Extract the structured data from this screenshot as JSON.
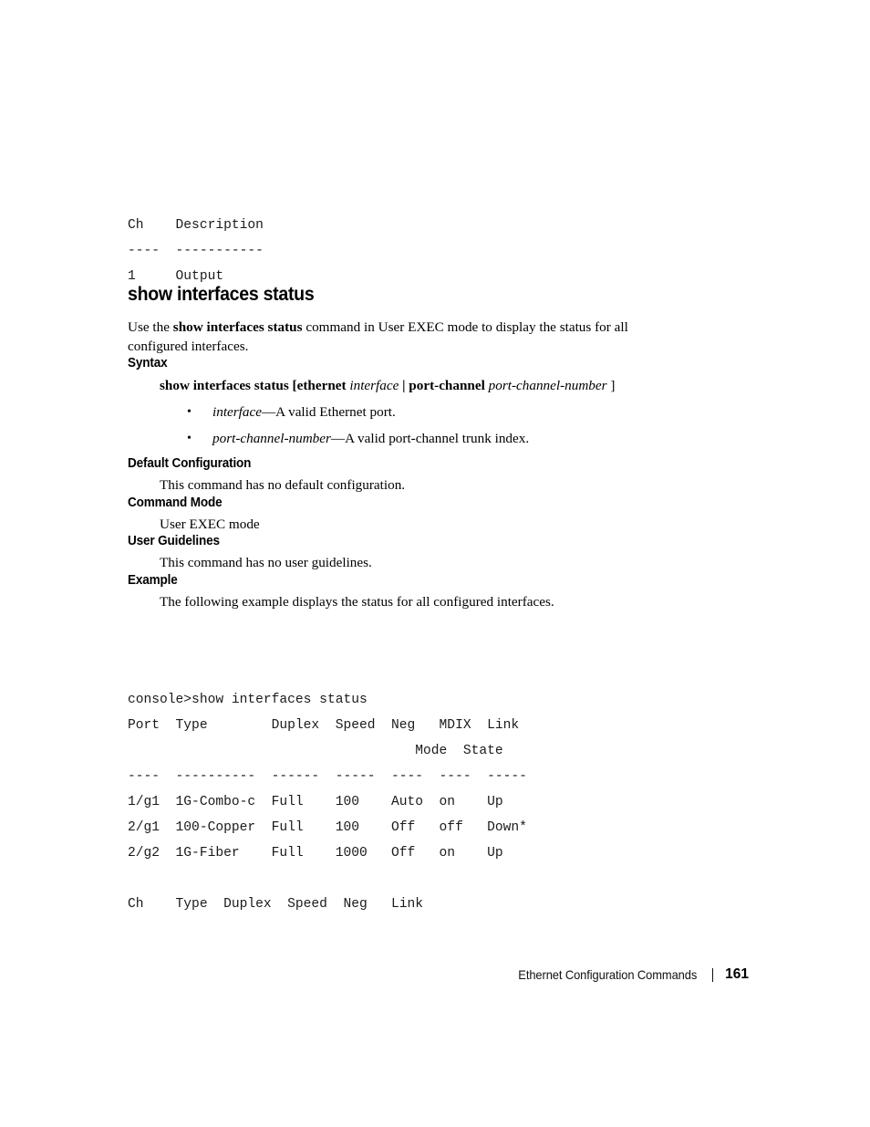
{
  "top_console": {
    "lines": [
      "Ch    Description",
      "----  -----------",
      "1     Output"
    ],
    "text": "Ch    Description\n----  -----------\n1     Output"
  },
  "command": {
    "heading": "show interfaces status",
    "intro": "Use the show interfaces status command in User EXEC mode to display the status for all configured interfaces.",
    "intro_lead": "Use the ",
    "intro_bold": "show interfaces status",
    "intro_rest": " command in User EXEC mode to display the status for all configured interfaces."
  },
  "sections": {
    "syntax": {
      "heading": "Syntax",
      "line": {
        "part1_bold": "show interfaces status [ethernet",
        "part2_italic": "interface",
        "part3_bold": "| port-channel",
        "part4_italic": "port-channel-number",
        "part5": "]"
      },
      "bullets": [
        {
          "term": "interface",
          "desc": "—A valid Ethernet port.",
          "marker": "•"
        },
        {
          "term": "port-channel-number",
          "desc": "—A valid port-channel trunk index.",
          "marker": "•"
        }
      ]
    },
    "default_configuration": {
      "heading": "Default Configuration",
      "body": "This command has no default configuration."
    },
    "command_mode": {
      "heading": "Command Mode",
      "body": "User EXEC mode"
    },
    "user_guidelines": {
      "heading": "User Guidelines",
      "body": "This command has no user guidelines."
    },
    "example": {
      "heading": "Example",
      "body": "The following example displays the status for all configured interfaces."
    }
  },
  "example_console": {
    "prompt_line": "console>show interfaces status",
    "port_table": {
      "headers_row1": [
        "Port",
        "Type",
        "Duplex",
        "Speed",
        "Neg",
        "MDIX",
        "Link"
      ],
      "headers_row2": [
        "",
        "",
        "",
        "",
        "",
        "Mode",
        "State"
      ],
      "separators": [
        "----",
        "----------",
        "------",
        "-----",
        "----",
        "----",
        "-----"
      ],
      "rows": [
        [
          "1/g1",
          "1G-Combo-c",
          "Full",
          "100",
          "Auto",
          "on",
          "Up"
        ],
        [
          "2/g1",
          "100-Copper",
          "Full",
          "100",
          "Off",
          "off",
          "Down*"
        ],
        [
          "2/g2",
          "1G-Fiber",
          "Full",
          "1000",
          "Off",
          "on",
          "Up"
        ]
      ]
    },
    "ch_table": {
      "headers": [
        "Ch",
        "Type",
        "Duplex",
        "Speed",
        "Neg",
        "Link"
      ]
    },
    "text": "console>show interfaces status\nPort  Type        Duplex  Speed  Neg   MDIX  Link\n                                    Mode  State\n----  ----------  ------  -----  ----  ----  -----\n1/g1  1G-Combo-c  Full    100    Auto  on    Up\n2/g1  100-Copper  Full    100    Off   off   Down*\n2/g2  1G-Fiber    Full    1000   Off   on    Up\n\nCh    Type  Duplex  Speed  Neg   Link"
  },
  "footer": {
    "chapter": "Ethernet Configuration Commands",
    "separator": "|",
    "page_number": "161"
  }
}
